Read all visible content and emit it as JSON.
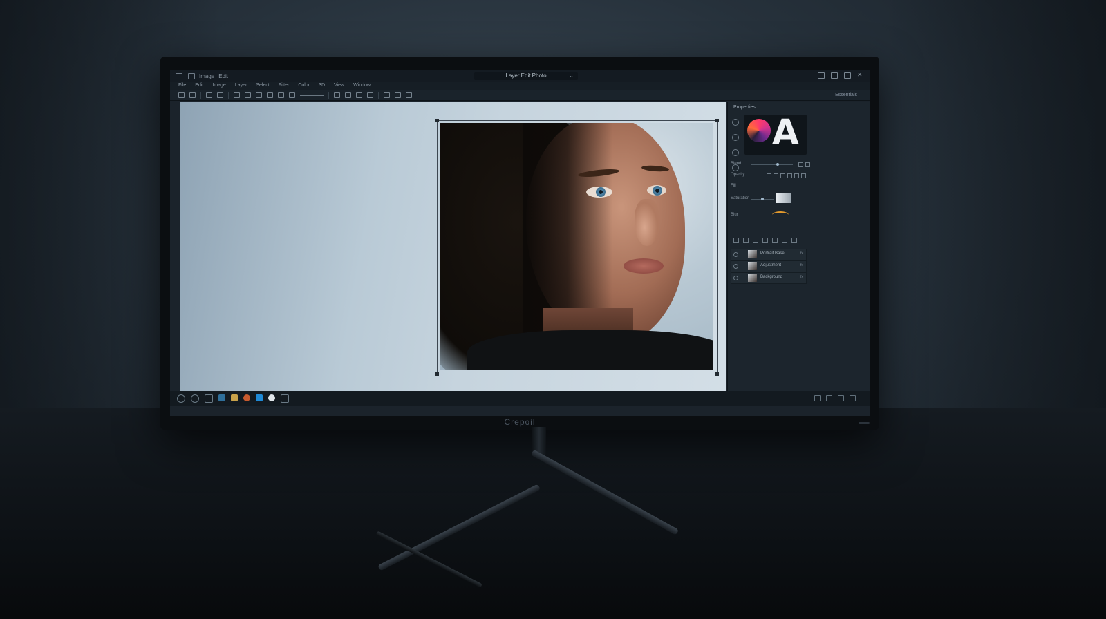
{
  "monitor": {
    "brand": "Crepoil"
  },
  "app": {
    "title_items": [
      "Image",
      "Edit"
    ],
    "document_tab": "Layer Edit Photo",
    "menu": [
      "File",
      "Edit",
      "Image",
      "Layer",
      "Select",
      "Filter",
      "Color",
      "3D",
      "View",
      "Window"
    ],
    "toolbar_right_label": "Essentials"
  },
  "panel": {
    "title": "Properties",
    "preview_glyph": "A",
    "rows": [
      {
        "label": "Blend",
        "value": 0.6
      },
      {
        "label": "Opacity",
        "value": ""
      },
      {
        "label": "Fill",
        "value": ""
      },
      {
        "label": "Saturation",
        "value": 0.45
      },
      {
        "label": "Blur",
        "value": ""
      }
    ],
    "layers": [
      {
        "name": "Portrait Base",
        "tag": "fx"
      },
      {
        "name": "Adjustment",
        "tag": "fx"
      },
      {
        "name": "Background",
        "tag": "fx"
      }
    ]
  },
  "colors": {
    "accent_orange": "#e39a2d",
    "canvas_bg": "#c6d4de",
    "ui_dark": "#1c252d"
  },
  "icons": [
    "menu-icon",
    "save-icon",
    "move-tool-icon",
    "crop-tool-icon",
    "brush-tool-icon",
    "text-tool-icon",
    "layer-icon",
    "eye-icon",
    "close-icon",
    "minimize-icon",
    "maximize-icon",
    "chevron-down-icon"
  ]
}
